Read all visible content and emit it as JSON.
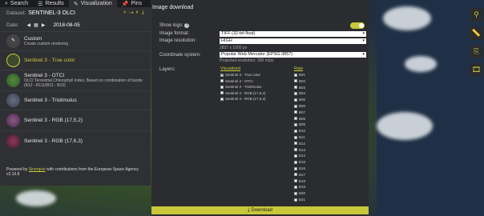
{
  "nav": {
    "tabs": [
      {
        "label": "Search",
        "icon": "search-icon"
      },
      {
        "label": "Results",
        "icon": "list-icon"
      },
      {
        "label": "Visualization",
        "icon": "brush-icon"
      },
      {
        "label": "Pins",
        "icon": "pin-icon"
      }
    ]
  },
  "dataset": {
    "label": "Dataset:",
    "value": "SENTINEL-3 OLCI"
  },
  "date": {
    "label": "Date:",
    "value": "2018-08-05"
  },
  "layers": [
    {
      "name": "Custom",
      "desc": "Create custom rendering",
      "selected": false
    },
    {
      "name": "Sentinel 3 - True color",
      "desc": "",
      "selected": true
    },
    {
      "name": "Sentinel 3 - OTCI",
      "desc": "OLCI Terrestrial Chlorophyll Index, Based on combination of bands (B12 - B11)/(B11 - B10)",
      "selected": false
    },
    {
      "name": "Sentinel 3 - Tristimulus",
      "desc": "",
      "selected": false
    },
    {
      "name": "Sentinel 3 - RGB (17,5,2)",
      "desc": "",
      "selected": false
    },
    {
      "name": "Sentinel 3 - RGB (17,6,3)",
      "desc": "",
      "selected": false
    }
  ],
  "footer": {
    "prefix": "Powered by",
    "link": "Sinergise",
    "suffix": "with contributions from the European Space Agency",
    "version": "v2.16.8"
  },
  "dialog": {
    "title": "Image download",
    "show_logo": "Show logo:",
    "image_format_label": "Image format:",
    "image_format": "TIFF (32-bit float)",
    "image_resolution_label": "Image resolution:",
    "image_resolution": "HIGH",
    "resolution_hint": "2837 x 1000 px",
    "coord_label": "Coordinate system:",
    "coord_value": "Popular Web Mercator (EPSG:3857)",
    "coord_hint": "Projected resolution: 300 m/px",
    "layers_label": "Layers:",
    "visualized_head": "Visualized",
    "raw_head": "Raw",
    "visualized": [
      {
        "label": "Sentinel 3 - True color",
        "checked": true
      },
      {
        "label": "Sentinel 3 - OTCI",
        "checked": false
      },
      {
        "label": "Sentinel 3 - Tristimulus",
        "checked": false
      },
      {
        "label": "Sentinel 3 - RGB (17,5,2)",
        "checked": false
      },
      {
        "label": "Sentinel 3 - RGB (17,6,3)",
        "checked": false
      }
    ],
    "raw": [
      "B01",
      "B02",
      "B03",
      "B04",
      "B05",
      "B06",
      "B07",
      "B08",
      "B09",
      "B10",
      "B11",
      "B12",
      "B13",
      "B14",
      "B15",
      "B16",
      "B17",
      "B18",
      "B19",
      "B20",
      "B21"
    ],
    "download_label": "Download"
  },
  "colors": {
    "accent": "#c8c83a",
    "panel": "#2f3033",
    "dialog": "#2b2c2f"
  },
  "rbar_icons": [
    "pin-marker-icon",
    "ruler-icon",
    "download-file-icon",
    "film-icon"
  ]
}
